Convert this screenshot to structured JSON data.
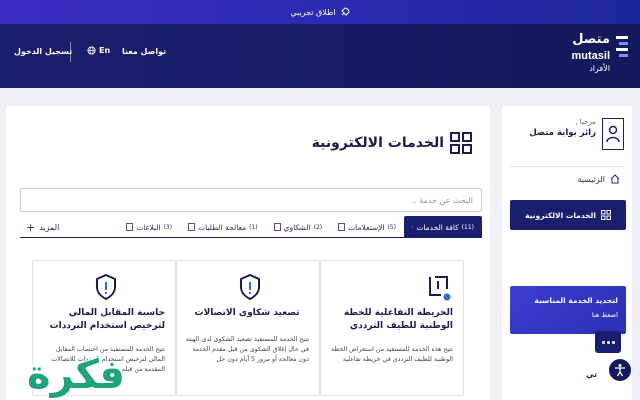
{
  "topbar": {
    "label": "اطلاق تجريبي",
    "icon": "rocket-icon"
  },
  "header": {
    "login_label": "تسجيل الدخول",
    "lang_label": "En",
    "contact_label": "تواصل معنا",
    "logo": {
      "arabic": "متصل",
      "latin": "mutasil",
      "sub": "الأفراد"
    }
  },
  "main": {
    "title": "الخدمات الالكترونية",
    "search_placeholder": "البحث عن خدمة ..",
    "tabs": [
      {
        "label": "كافة الخدمات",
        "count": "(11)"
      },
      {
        "label": "الإستعلامات",
        "count": "(5)"
      },
      {
        "label": "الشكاوي",
        "count": "(2)"
      },
      {
        "label": "معالجة الطلبات",
        "count": "(1)"
      },
      {
        "label": "البلاغات",
        "count": "(3)"
      }
    ],
    "more_label": "المزيد",
    "cards": [
      {
        "title": "الخريطة التفاعلية للخطة الوطنية للطيف الترددي",
        "desc": "تتيح هذه الخدمة للمستفيد من استعراض الخطة الوطنية للطيف الترددي في خريطة تفاعلية",
        "icon": "map-icon"
      },
      {
        "title": "تصعيد شكاوى الاتصالات",
        "desc": "تتيح الخدمة للمستفيد تصعيد الشكوى لدى الهيئة في حال إغلاق الشكوى من قبل مقدم الخدمة دون معالجة أو مرور 5 أيام دون حل",
        "icon": "alert-shield-icon"
      },
      {
        "title": "حاسبة المقابل المالي لترخيص استخدام الترددات",
        "desc": "تتيح الخدمة للمستفيد من احتساب المقابل المالي لترخيص استخدام الترددات للاتصالات المقدمة من قبله",
        "icon": "alert-shield-icon"
      }
    ]
  },
  "sidebar": {
    "greeting": "مرحبا ,",
    "user_name": "زائر بوابة متصل",
    "home_label": "الرئيسية",
    "eservices_label": "الخدمات الالكترونية",
    "promo_title": "لتحديد الخدمة المناسبة",
    "promo_link": "اضغط هنا",
    "bottom_text": "تي"
  },
  "watermark": {
    "text": "فكرة"
  },
  "colors": {
    "navy": "#1a1e6e",
    "accent": "#3b2dc2",
    "watermark_green": "#1fa37a"
  }
}
